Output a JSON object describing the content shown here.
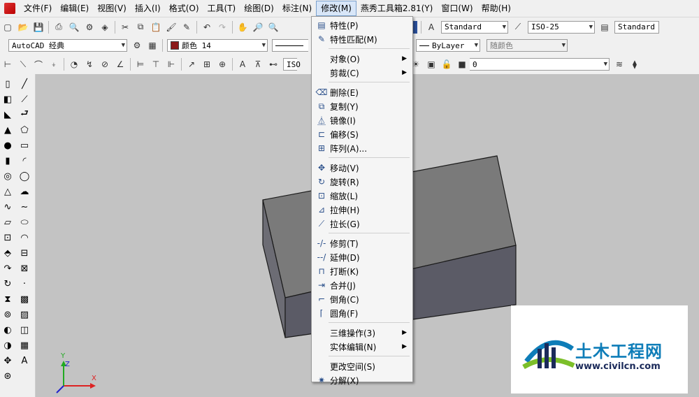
{
  "menubar": {
    "items": [
      "文件(F)",
      "编辑(E)",
      "视图(V)",
      "插入(I)",
      "格式(O)",
      "工具(T)",
      "绘图(D)",
      "标注(N)",
      "修改(M)",
      "燕秀工具箱2.81(Y)",
      "窗口(W)",
      "帮助(H)"
    ],
    "active_index": 8
  },
  "toolbar1": {
    "text_style": "Standard",
    "dim_style": "ISO-25",
    "table_style": "Standard"
  },
  "toolbar2": {
    "workspace": "AutoCAD 经典",
    "color": "颜色 14",
    "color_hex": "#8b1a1a",
    "lineweight": "ByLayer",
    "plot_style": "随颜色"
  },
  "toolbar3": {
    "dim_combo": "ISO",
    "layer": "0"
  },
  "modify_menu": {
    "items": [
      {
        "label": "特性(P)",
        "icon": "properties-icon",
        "submenu": false
      },
      {
        "label": "特性匹配(M)",
        "icon": "match-brush-icon",
        "submenu": false
      },
      {
        "label": "对象(O)",
        "icon": "",
        "submenu": true
      },
      {
        "label": "剪裁(C)",
        "icon": "",
        "submenu": true
      },
      {
        "label": "删除(E)",
        "icon": "eraser-icon",
        "submenu": false
      },
      {
        "label": "复制(Y)",
        "icon": "copy-icon",
        "submenu": false
      },
      {
        "label": "镜像(I)",
        "icon": "mirror-icon",
        "submenu": false
      },
      {
        "label": "偏移(S)",
        "icon": "offset-icon",
        "submenu": false
      },
      {
        "label": "阵列(A)...",
        "icon": "array-icon",
        "submenu": false
      },
      {
        "label": "移动(V)",
        "icon": "move-icon",
        "submenu": false
      },
      {
        "label": "旋转(R)",
        "icon": "rotate-icon",
        "submenu": false
      },
      {
        "label": "缩放(L)",
        "icon": "scale-icon",
        "submenu": false
      },
      {
        "label": "拉伸(H)",
        "icon": "stretch-icon",
        "submenu": false
      },
      {
        "label": "拉长(G)",
        "icon": "lengthen-icon",
        "submenu": false
      },
      {
        "label": "修剪(T)",
        "icon": "trim-icon",
        "submenu": false
      },
      {
        "label": "延伸(D)",
        "icon": "extend-icon",
        "submenu": false
      },
      {
        "label": "打断(K)",
        "icon": "break-icon",
        "submenu": false
      },
      {
        "label": "合并(J)",
        "icon": "join-icon",
        "submenu": false
      },
      {
        "label": "倒角(C)",
        "icon": "chamfer-icon",
        "submenu": false
      },
      {
        "label": "圆角(F)",
        "icon": "fillet-icon",
        "submenu": false
      },
      {
        "label": "三维操作(3)",
        "icon": "",
        "submenu": true
      },
      {
        "label": "实体编辑(N)",
        "icon": "",
        "submenu": true
      },
      {
        "label": "更改空间(S)",
        "icon": "",
        "submenu": false
      },
      {
        "label": "分解(X)",
        "icon": "explode-icon",
        "submenu": false
      }
    ]
  },
  "ucs": {
    "x": "X",
    "y": "Y",
    "z": "Z"
  },
  "watermark": {
    "title": "土木工程网",
    "url": "www.civilcn.com"
  },
  "colors": {
    "box_top": "#7a7a7a",
    "box_front": "#5b5b66",
    "box_side": "#6c6c74",
    "canvas": "#c3c3c3"
  }
}
